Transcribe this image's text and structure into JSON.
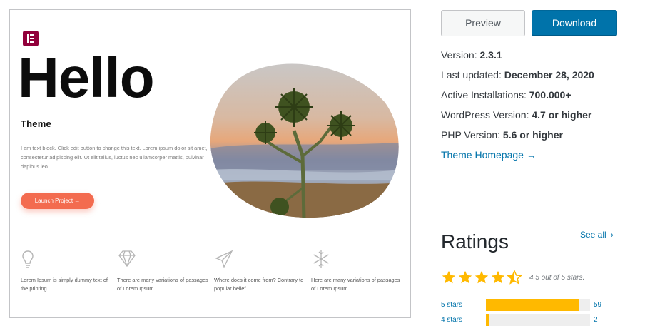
{
  "screenshot": {
    "hero_title": "Hello",
    "hero_subtitle": "Theme",
    "hero_text": "I am text block. Click edit button to change this text. Lorem ipsum dolor sit amet, consectetur adipiscing elit. Ut elit tellus, luctus nec ullamcorper mattis, pulvinar dapibus leo.",
    "cta_label": "Launch Project →",
    "features": [
      {
        "icon": "lightbulb-icon",
        "text": "Lorem Ipsum is simply dummy text of the printing"
      },
      {
        "icon": "diamond-icon",
        "text": "There are many variations of passages of Lorem Ipsum"
      },
      {
        "icon": "paper-plane-icon",
        "text": "Where does it come from? Contrary to popular belief"
      },
      {
        "icon": "snowflake-icon",
        "text": "Here are many variations of passages of Lorem Ipsum"
      }
    ],
    "accent_color": "#f36b4f",
    "logo_color": "#92003b"
  },
  "actions": {
    "preview_label": "Preview",
    "download_label": "Download"
  },
  "meta": {
    "version_label": "Version:",
    "version_value": "2.3.1",
    "updated_label": "Last updated:",
    "updated_value": "December 28, 2020",
    "installs_label": "Active Installations:",
    "installs_value": "700.000+",
    "wp_label": "WordPress Version:",
    "wp_value": "4.7 or higher",
    "php_label": "PHP Version:",
    "php_value": "5.6 or higher",
    "homepage_label": "Theme Homepage →"
  },
  "ratings": {
    "title": "Ratings",
    "see_all": "See all",
    "stars_value": 4.5,
    "summary": "4.5 out of 5 stars.",
    "rows": [
      {
        "label": "5 stars",
        "count": "59",
        "fraction": 0.89
      },
      {
        "label": "4 stars",
        "count": "2",
        "fraction": 0.03
      }
    ],
    "star_color": "#ffb900"
  }
}
